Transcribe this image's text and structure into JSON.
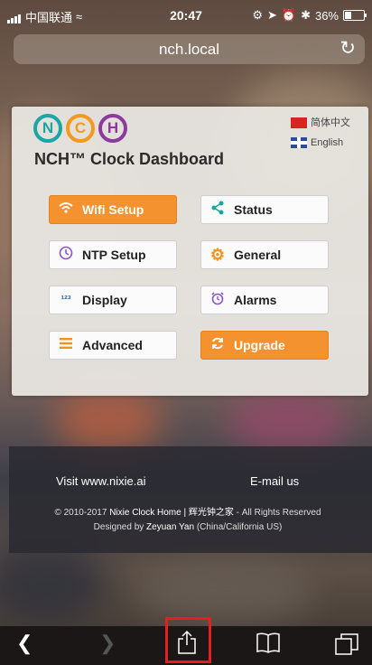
{
  "status_bar": {
    "carrier": "中国联通",
    "time": "20:47",
    "battery": "36%"
  },
  "browser": {
    "url": "nch.local"
  },
  "dashboard": {
    "logo_letters": [
      "N",
      "C",
      "H"
    ],
    "languages": [
      "简体中文",
      "English"
    ],
    "title": "NCH™ Clock Dashboard",
    "buttons": [
      {
        "label": "Wifi Setup",
        "icon": "wifi-icon"
      },
      {
        "label": "Status",
        "icon": "share-nodes-icon"
      },
      {
        "label": "NTP Setup",
        "icon": "clock-icon"
      },
      {
        "label": "General",
        "icon": "gear-icon"
      },
      {
        "label": "Display",
        "icon": "numbers-icon"
      },
      {
        "label": "Alarms",
        "icon": "alarm-clock-icon"
      },
      {
        "label": "Advanced",
        "icon": "menu-bars-icon"
      },
      {
        "label": "Upgrade",
        "icon": "refresh-icon"
      }
    ]
  },
  "footer": {
    "visit": "Visit www.nixie.ai",
    "email": "E-mail us",
    "copyright_prefix": "© 2010-2017",
    "copyright_name": "Nixie Clock Home | 辉光钟之家",
    "copyright_suffix": "- All Rights Reserved",
    "designed_by_label": "Designed by",
    "designer": "Zeyuan Yan",
    "designer_location": "(China/California US)"
  },
  "colors": {
    "accent_orange": "#f3922f",
    "logo_teal": "#1aa6a6",
    "logo_orange": "#f39a1e",
    "logo_purple": "#8b3a9e"
  }
}
